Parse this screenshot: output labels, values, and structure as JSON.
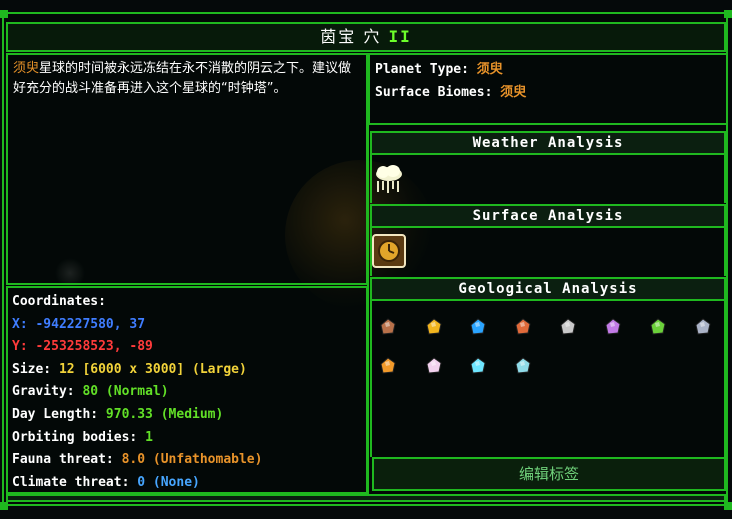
{
  "title": {
    "name": "茵宝 穴",
    "numeral": "II"
  },
  "description": {
    "highlight": "须臾",
    "text": "星球的时间被永远冻结在永不消散的阴云之下。建议做好充分的战斗准备再进入这个星球的“时钟塔”。"
  },
  "planet": {
    "type_label": "Planet Type:",
    "type_value": "须臾",
    "biomes_label": "Surface Biomes:",
    "biomes_value": "须臾"
  },
  "stats": {
    "coordinates_label": "Coordinates:",
    "x_label": "X:",
    "x_value": "-942227580, 37",
    "y_label": "Y:",
    "y_value": "-253258523, -89",
    "size_label": "Size:",
    "size_value": "12 [6000 x 3000] (Large)",
    "gravity_label": "Gravity:",
    "gravity_value": "80 (Normal)",
    "day_label": "Day Length:",
    "day_value": "970.33 (Medium)",
    "orbit_label": "Orbiting bodies:",
    "orbit_value": "1",
    "fauna_label": "Fauna threat:",
    "fauna_value": "8.0 (Unfathomable)",
    "climate_label": "Climate threat:",
    "climate_value": "0 (None)"
  },
  "sections": {
    "weather": "Weather Analysis",
    "surface": "Surface Analysis",
    "geological": "Geological Analysis"
  },
  "weather_icons": [
    "snow-cloud-icon"
  ],
  "surface_icons": [
    "clock-tile-icon"
  ],
  "geological_icons": [
    {
      "name": "copper-ore-icon",
      "color": "#b8714a"
    },
    {
      "name": "gold-ore-icon",
      "color": "#f2b51e"
    },
    {
      "name": "crystal-ore-icon",
      "color": "#2aa4ff"
    },
    {
      "name": "iron-ore-icon",
      "color": "#e06a3a"
    },
    {
      "name": "silver-ore-icon",
      "color": "#c9c9c9"
    },
    {
      "name": "violet-shard-icon",
      "color": "#c27be6"
    },
    {
      "name": "moss-ore-icon",
      "color": "#6bd13a"
    },
    {
      "name": "platinum-ore-icon",
      "color": "#aab3c7"
    },
    {
      "name": "amber-ore-icon",
      "color": "#f29a2a"
    },
    {
      "name": "pearl-ore-icon",
      "color": "#f2d2ee"
    },
    {
      "name": "diamond-ore-icon",
      "color": "#6ee6ff"
    },
    {
      "name": "ice-shard-icon",
      "color": "#8fdbe8"
    }
  ],
  "edit_button": "编辑标签"
}
